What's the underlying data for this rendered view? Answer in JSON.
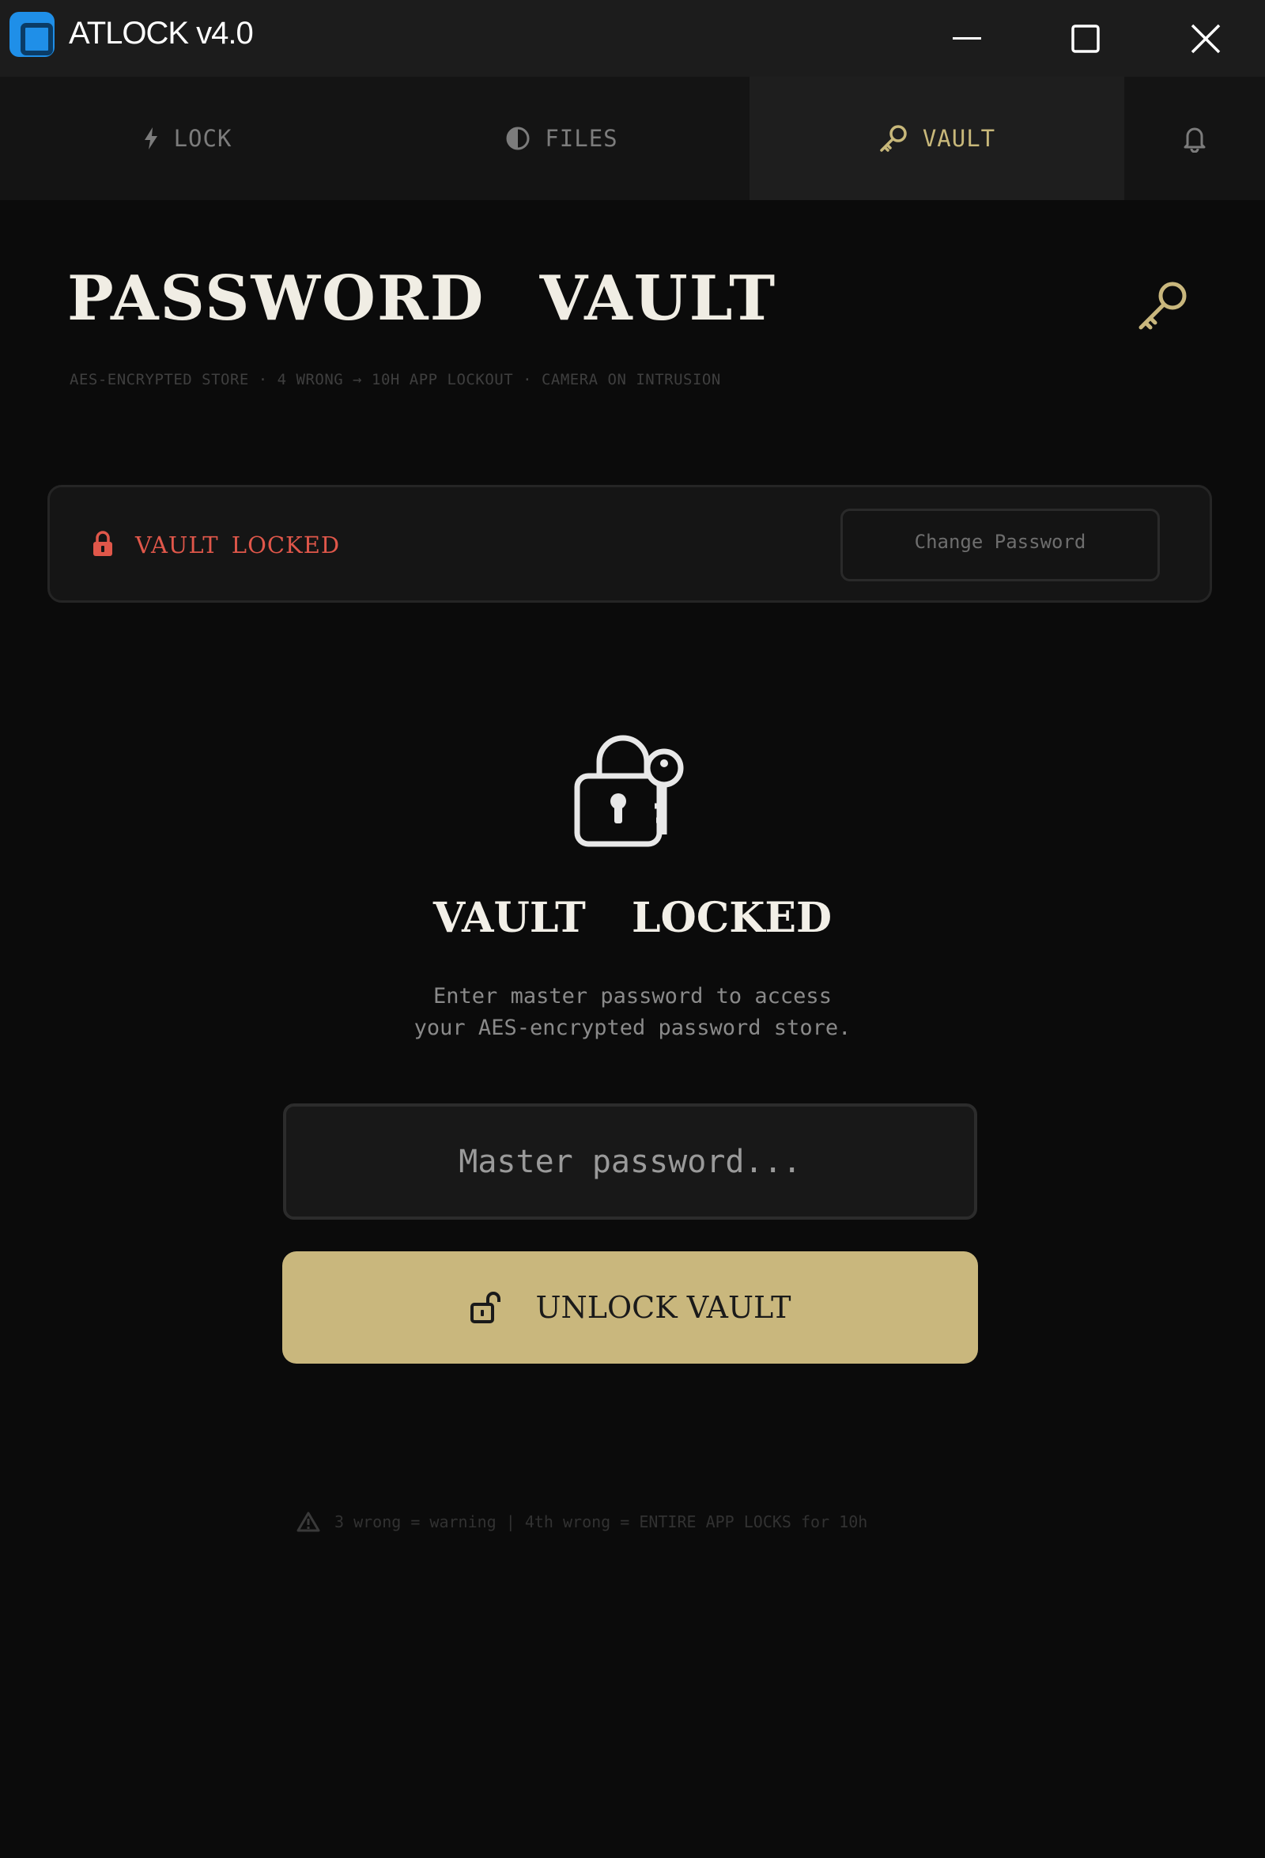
{
  "window": {
    "title": "ATLOCK  v4.0",
    "icon": "app-logo-icon"
  },
  "tabs": [
    {
      "label": "LOCK",
      "icon": "bolt-icon",
      "active": false
    },
    {
      "label": "FILES",
      "icon": "half-circle-icon",
      "active": false
    },
    {
      "label": "VAULT",
      "icon": "key-icon",
      "active": true
    },
    {
      "label": "",
      "icon": "bell-icon",
      "active": false
    }
  ],
  "header": {
    "title": "PASSWORD  VAULT",
    "subtitle": "AES-ENCRYPTED STORE  ·  4 WRONG → 10H APP LOCKOUT  ·  CAMERA ON INTRUSION"
  },
  "status": {
    "text": "VAULT LOCKED",
    "change_password_label": "Change Password"
  },
  "lock_panel": {
    "heading": "VAULT  LOCKED",
    "description_line1": "Enter master password to access",
    "description_line2": "your AES-encrypted password store.",
    "password_placeholder": "Master password...",
    "unlock_label": "UNLOCK VAULT"
  },
  "footer": {
    "warning": "3 wrong = warning  |  4th wrong = ENTIRE APP LOCKS for 10h"
  },
  "colors": {
    "accent": "#c9b77d",
    "danger": "#e0574a",
    "background": "#0b0b0b"
  }
}
